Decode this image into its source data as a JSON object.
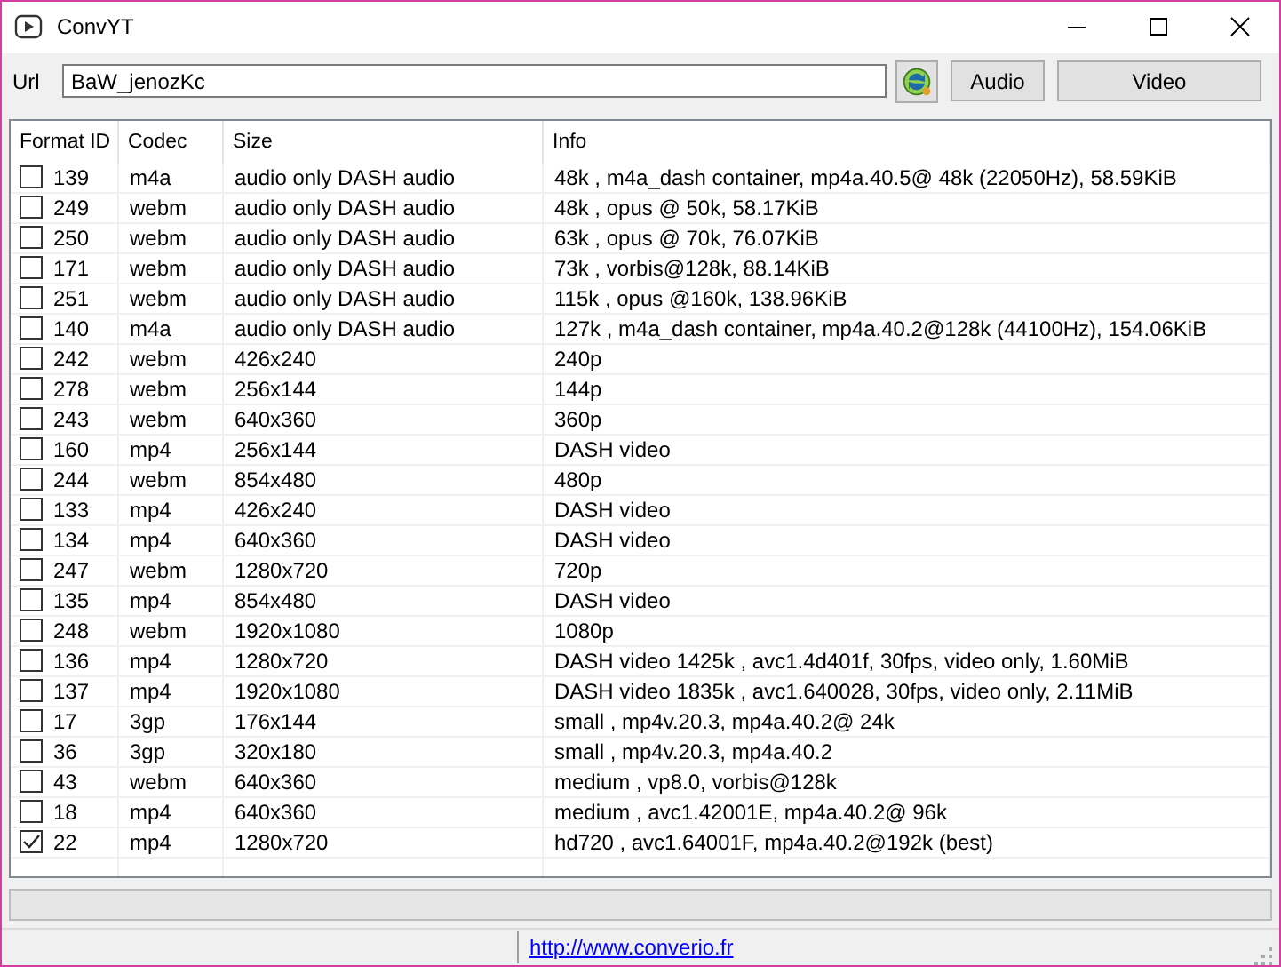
{
  "window": {
    "title": "ConvYT"
  },
  "url_bar": {
    "label": "Url",
    "value": "BaW_jenozKc"
  },
  "buttons": [
    "Audio",
    "Video"
  ],
  "table": {
    "columns": [
      "Format ID",
      "Codec",
      "Size",
      "Info"
    ],
    "rows": [
      {
        "checked": false,
        "id": "139",
        "codec": "m4a",
        "size": "audio only DASH audio",
        "info": "48k , m4a_dash container, mp4a.40.5@ 48k (22050Hz), 58.59KiB"
      },
      {
        "checked": false,
        "id": "249",
        "codec": "webm",
        "size": "audio only DASH audio",
        "info": "48k , opus @ 50k, 58.17KiB"
      },
      {
        "checked": false,
        "id": "250",
        "codec": "webm",
        "size": "audio only DASH audio",
        "info": "63k , opus @ 70k, 76.07KiB"
      },
      {
        "checked": false,
        "id": "171",
        "codec": "webm",
        "size": "audio only DASH audio",
        "info": "73k , vorbis@128k, 88.14KiB"
      },
      {
        "checked": false,
        "id": "251",
        "codec": "webm",
        "size": "audio only DASH audio",
        "info": "115k , opus @160k, 138.96KiB"
      },
      {
        "checked": false,
        "id": "140",
        "codec": "m4a",
        "size": "audio only DASH audio",
        "info": "127k , m4a_dash container, mp4a.40.2@128k (44100Hz), 154.06KiB"
      },
      {
        "checked": false,
        "id": "242",
        "codec": "webm",
        "size": "426x240",
        "info": "240p"
      },
      {
        "checked": false,
        "id": "278",
        "codec": "webm",
        "size": "256x144",
        "info": "144p"
      },
      {
        "checked": false,
        "id": "243",
        "codec": "webm",
        "size": "640x360",
        "info": "360p"
      },
      {
        "checked": false,
        "id": "160",
        "codec": "mp4",
        "size": "256x144",
        "info": "DASH video"
      },
      {
        "checked": false,
        "id": "244",
        "codec": "webm",
        "size": "854x480",
        "info": "480p"
      },
      {
        "checked": false,
        "id": "133",
        "codec": "mp4",
        "size": "426x240",
        "info": "DASH video"
      },
      {
        "checked": false,
        "id": "134",
        "codec": "mp4",
        "size": "640x360",
        "info": "DASH video"
      },
      {
        "checked": false,
        "id": "247",
        "codec": "webm",
        "size": "1280x720",
        "info": "720p"
      },
      {
        "checked": false,
        "id": "135",
        "codec": "mp4",
        "size": "854x480",
        "info": "DASH video"
      },
      {
        "checked": false,
        "id": "248",
        "codec": "webm",
        "size": "1920x1080",
        "info": "1080p"
      },
      {
        "checked": false,
        "id": "136",
        "codec": "mp4",
        "size": "1280x720",
        "info": "DASH video 1425k , avc1.4d401f, 30fps, video only, 1.60MiB"
      },
      {
        "checked": false,
        "id": "137",
        "codec": "mp4",
        "size": "1920x1080",
        "info": "DASH video 1835k , avc1.640028, 30fps, video only, 2.11MiB"
      },
      {
        "checked": false,
        "id": "17",
        "codec": "3gp",
        "size": "176x144",
        "info": "small , mp4v.20.3, mp4a.40.2@ 24k"
      },
      {
        "checked": false,
        "id": "36",
        "codec": "3gp",
        "size": "320x180",
        "info": "small , mp4v.20.3, mp4a.40.2"
      },
      {
        "checked": false,
        "id": "43",
        "codec": "webm",
        "size": "640x360",
        "info": "medium , vp8.0, vorbis@128k"
      },
      {
        "checked": false,
        "id": "18",
        "codec": "mp4",
        "size": "640x360",
        "info": "medium , avc1.42001E, mp4a.40.2@ 96k"
      },
      {
        "checked": true,
        "id": "22",
        "codec": "mp4",
        "size": "1280x720",
        "info": "hd720 , avc1.64001F, mp4a.40.2@192k (best)"
      }
    ]
  },
  "progress": {
    "level": 0
  },
  "status_bar": {
    "link": "http://www.converio.fr"
  }
}
